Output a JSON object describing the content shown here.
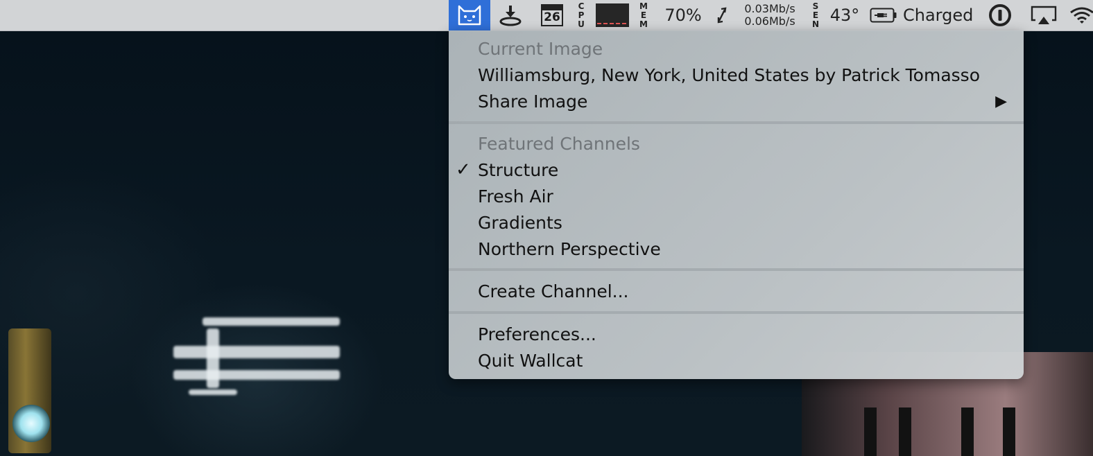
{
  "menubar": {
    "app_icon": "cat-icon",
    "download_icon": "download-icon",
    "calendar_day": "26",
    "cpu_label": [
      "C",
      "P",
      "U"
    ],
    "mem_label": [
      "M",
      "E",
      "M"
    ],
    "mem_percent": "70%",
    "network_icon": "network-arrows-icon",
    "net_up": "0.03Mb/s",
    "net_down": "0.06Mb/s",
    "sensor_label": [
      "S",
      "E",
      "N"
    ],
    "temperature": "43°",
    "battery_icon": "battery-plug-icon",
    "battery_status": "Charged",
    "password_icon": "1password-icon",
    "airplay_icon": "airplay-icon",
    "wifi_icon": "wifi-icon"
  },
  "menu": {
    "section_current": "Current Image",
    "image_credit": "Williamsburg, New York, United States by Patrick Tomasso",
    "share_image": "Share Image",
    "submenu_arrow": "▶",
    "section_featured": "Featured Channels",
    "check_mark": "✓",
    "channels": [
      "Structure",
      "Fresh Air",
      "Gradients",
      "Northern Perspective"
    ],
    "create_channel": "Create Channel...",
    "preferences": "Preferences...",
    "quit": "Quit Wallcat"
  }
}
